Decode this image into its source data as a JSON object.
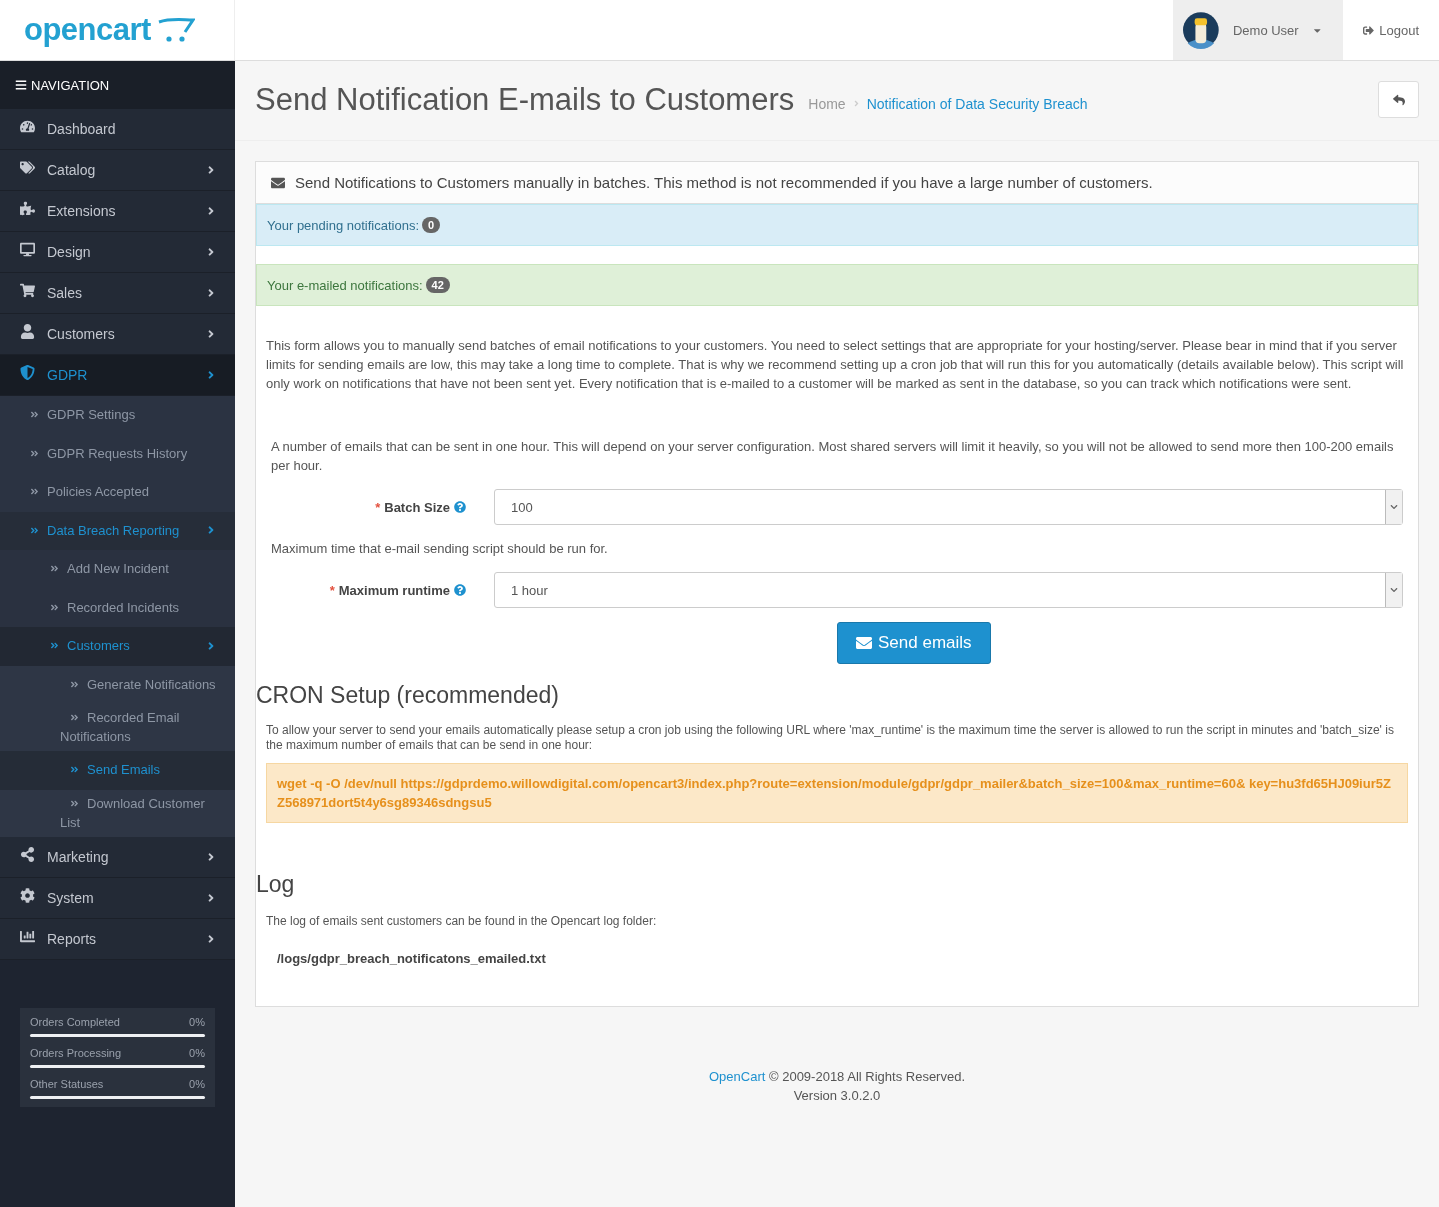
{
  "header": {
    "logo": "opencart",
    "user": {
      "name": "Demo User"
    },
    "logout": "Logout"
  },
  "sidebar": {
    "title": "NAVIGATION",
    "items": [
      {
        "label": "Dashboard",
        "expandable": false,
        "selected": false
      },
      {
        "label": "Catalog",
        "expandable": true,
        "selected": false
      },
      {
        "label": "Extensions",
        "expandable": true,
        "selected": false
      },
      {
        "label": "Design",
        "expandable": true,
        "selected": false
      },
      {
        "label": "Sales",
        "expandable": true,
        "selected": false
      },
      {
        "label": "Customers",
        "expandable": true,
        "selected": false
      },
      {
        "label": "GDPR",
        "expandable": true,
        "selected": true,
        "children": [
          {
            "label": "GDPR Settings",
            "expandable": false,
            "selected": false
          },
          {
            "label": "GDPR Requests History",
            "expandable": false,
            "selected": false
          },
          {
            "label": "Policies Accepted",
            "expandable": false,
            "selected": false
          },
          {
            "label": "Data Breach Reporting",
            "expandable": true,
            "selected": true,
            "children": [
              {
                "label": "Add New Incident",
                "expandable": false,
                "selected": false
              },
              {
                "label": "Recorded Incidents",
                "expandable": false,
                "selected": false
              },
              {
                "label": "Customers",
                "expandable": true,
                "selected": true,
                "children": [
                  {
                    "label": "Generate Notifications",
                    "expandable": false,
                    "selected": false
                  },
                  {
                    "label": "Recorded Email Notifications",
                    "expandable": false,
                    "selected": false
                  },
                  {
                    "label": "Send Emails",
                    "expandable": false,
                    "selected": true
                  },
                  {
                    "label": "Download Customer List",
                    "expandable": false,
                    "selected": false
                  }
                ]
              }
            ]
          }
        ]
      },
      {
        "label": "Marketing",
        "expandable": true,
        "selected": false
      },
      {
        "label": "System",
        "expandable": true,
        "selected": false
      },
      {
        "label": "Reports",
        "expandable": true,
        "selected": false
      }
    ],
    "stats": [
      {
        "label": "Orders Completed",
        "reading": "0%",
        "level": 0
      },
      {
        "label": "Orders Processing",
        "reading": "0%",
        "level": 0
      },
      {
        "label": "Other Statuses",
        "reading": "0%",
        "level": 0
      }
    ]
  },
  "page": {
    "title": "Send Notification E-mails to Customers",
    "breadcrumbs": [
      {
        "label": "Home",
        "selected": false
      },
      {
        "label": "Notification of Data Security Breach",
        "selected": true
      }
    ]
  },
  "panel": {
    "heading": "Send Notifications to Customers manually in batches. This method is not recommended if you have a large number of customers.",
    "alerts": [
      {
        "kind": "info",
        "text": "Your pending notifications:",
        "count": "0"
      },
      {
        "kind": "success",
        "text": "Your e-mailed notifications:",
        "count": "42"
      }
    ],
    "intro": "This form allows you to manually send batches of email notifications to your customers. You need to select settings that are appropriate for your hosting/server. Please bear in mind that if you server limits for sending emails are low, this may take a long time to complete. That is why we recommend setting up a cron job that will run this for you automatically (details available below). This script will only work on notifications that have not been sent yet. Every notification that is e-mailed to a customer will be marked as sent in the database, so you can track which notifications were sent.",
    "fields": [
      {
        "help": "A number of emails that can be sent in one hour. This will depend on your server configuration. Most shared servers will limit it heavily, so you will not be allowed to send more then 100-200 emails per hour.",
        "marker": "*",
        "label": "Batch Size",
        "value": "100"
      },
      {
        "help": "Maximum time that e-mail sending script should be run for.",
        "marker": "*",
        "label": "Maximum runtime",
        "value": "1 hour"
      }
    ],
    "send_button": "Send emails",
    "cron": {
      "title": "CRON Setup (recommended)",
      "text": "To allow your server to send your emails automatically please setup a cron job using the following URL where 'max_runtime' is the maximum time the server is allowed to run the script in minutes and 'batch_size' is the maximum number of emails that can be send in one hour:",
      "command": "wget -q -O /dev/null https://gdprdemo.willowdigital.com/opencart3/index.php?route=extension/module/gdpr/gdpr_mailer&batch_size=100&max_runtime=60& key=hu3fd65HJ09iur5ZZ568971dort5t4y6sg89346sdngsu5"
    },
    "log": {
      "title": "Log",
      "text": "The log of emails sent customers can be found in the Opencart log folder:",
      "path": "/logs/gdpr_breach_notificatons_emailed.txt"
    }
  },
  "footer": {
    "link": "OpenCart",
    "text": "© 2009-2018 All Rights Reserved.",
    "version": "Version 3.0.2.0"
  }
}
